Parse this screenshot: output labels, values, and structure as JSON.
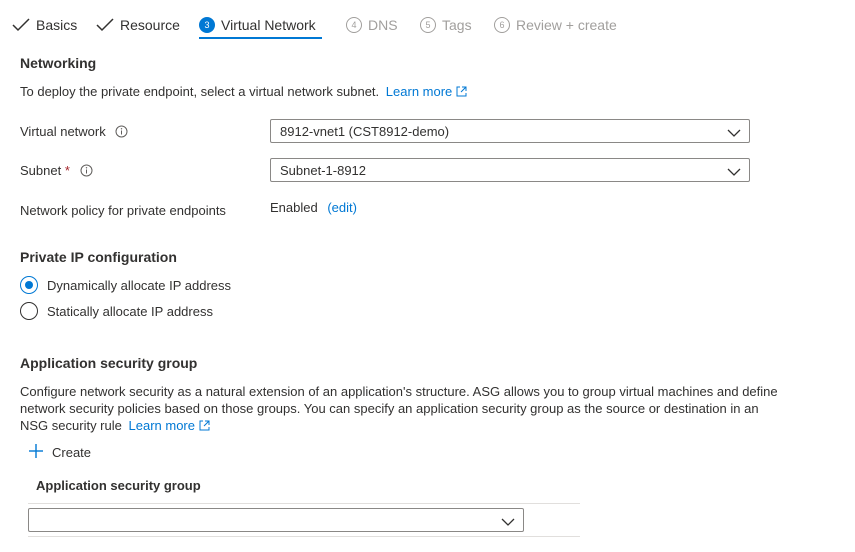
{
  "wizard": {
    "tabs": [
      {
        "label": "Basics",
        "state": "done"
      },
      {
        "label": "Resource",
        "state": "done"
      },
      {
        "label": "Virtual Network",
        "state": "active",
        "number": "3"
      },
      {
        "label": "DNS",
        "state": "disabled",
        "number": "4"
      },
      {
        "label": "Tags",
        "state": "disabled",
        "number": "5"
      },
      {
        "label": "Review + create",
        "state": "disabled",
        "number": "6"
      }
    ]
  },
  "networking": {
    "heading": "Networking",
    "description": "To deploy the private endpoint, select a virtual network subnet.",
    "learn_more": "Learn more",
    "virtual_network_label": "Virtual network",
    "virtual_network_value": "8912-vnet1 (CST8912-demo)",
    "subnet_label": "Subnet",
    "subnet_required": "*",
    "subnet_value": "Subnet-1-8912",
    "policy_label": "Network policy for private endpoints",
    "policy_value": "Enabled",
    "policy_edit": "(edit)"
  },
  "private_ip": {
    "heading": "Private IP configuration",
    "options": [
      {
        "label": "Dynamically allocate IP address",
        "checked": true
      },
      {
        "label": "Statically allocate IP address",
        "checked": false
      }
    ]
  },
  "asg": {
    "heading": "Application security group",
    "description": "Configure network security as a natural extension of an application's structure. ASG allows you to group virtual machines and define network security policies based on those groups. You can specify an application security group as the source or destination in an NSG security rule",
    "learn_more": "Learn more",
    "create_label": "Create",
    "column_header": "Application security group",
    "dropdown_value": ""
  },
  "colors": {
    "accent": "#0078d4",
    "text": "#323130",
    "disabled": "#a19f9d",
    "border": "#8a8886"
  }
}
